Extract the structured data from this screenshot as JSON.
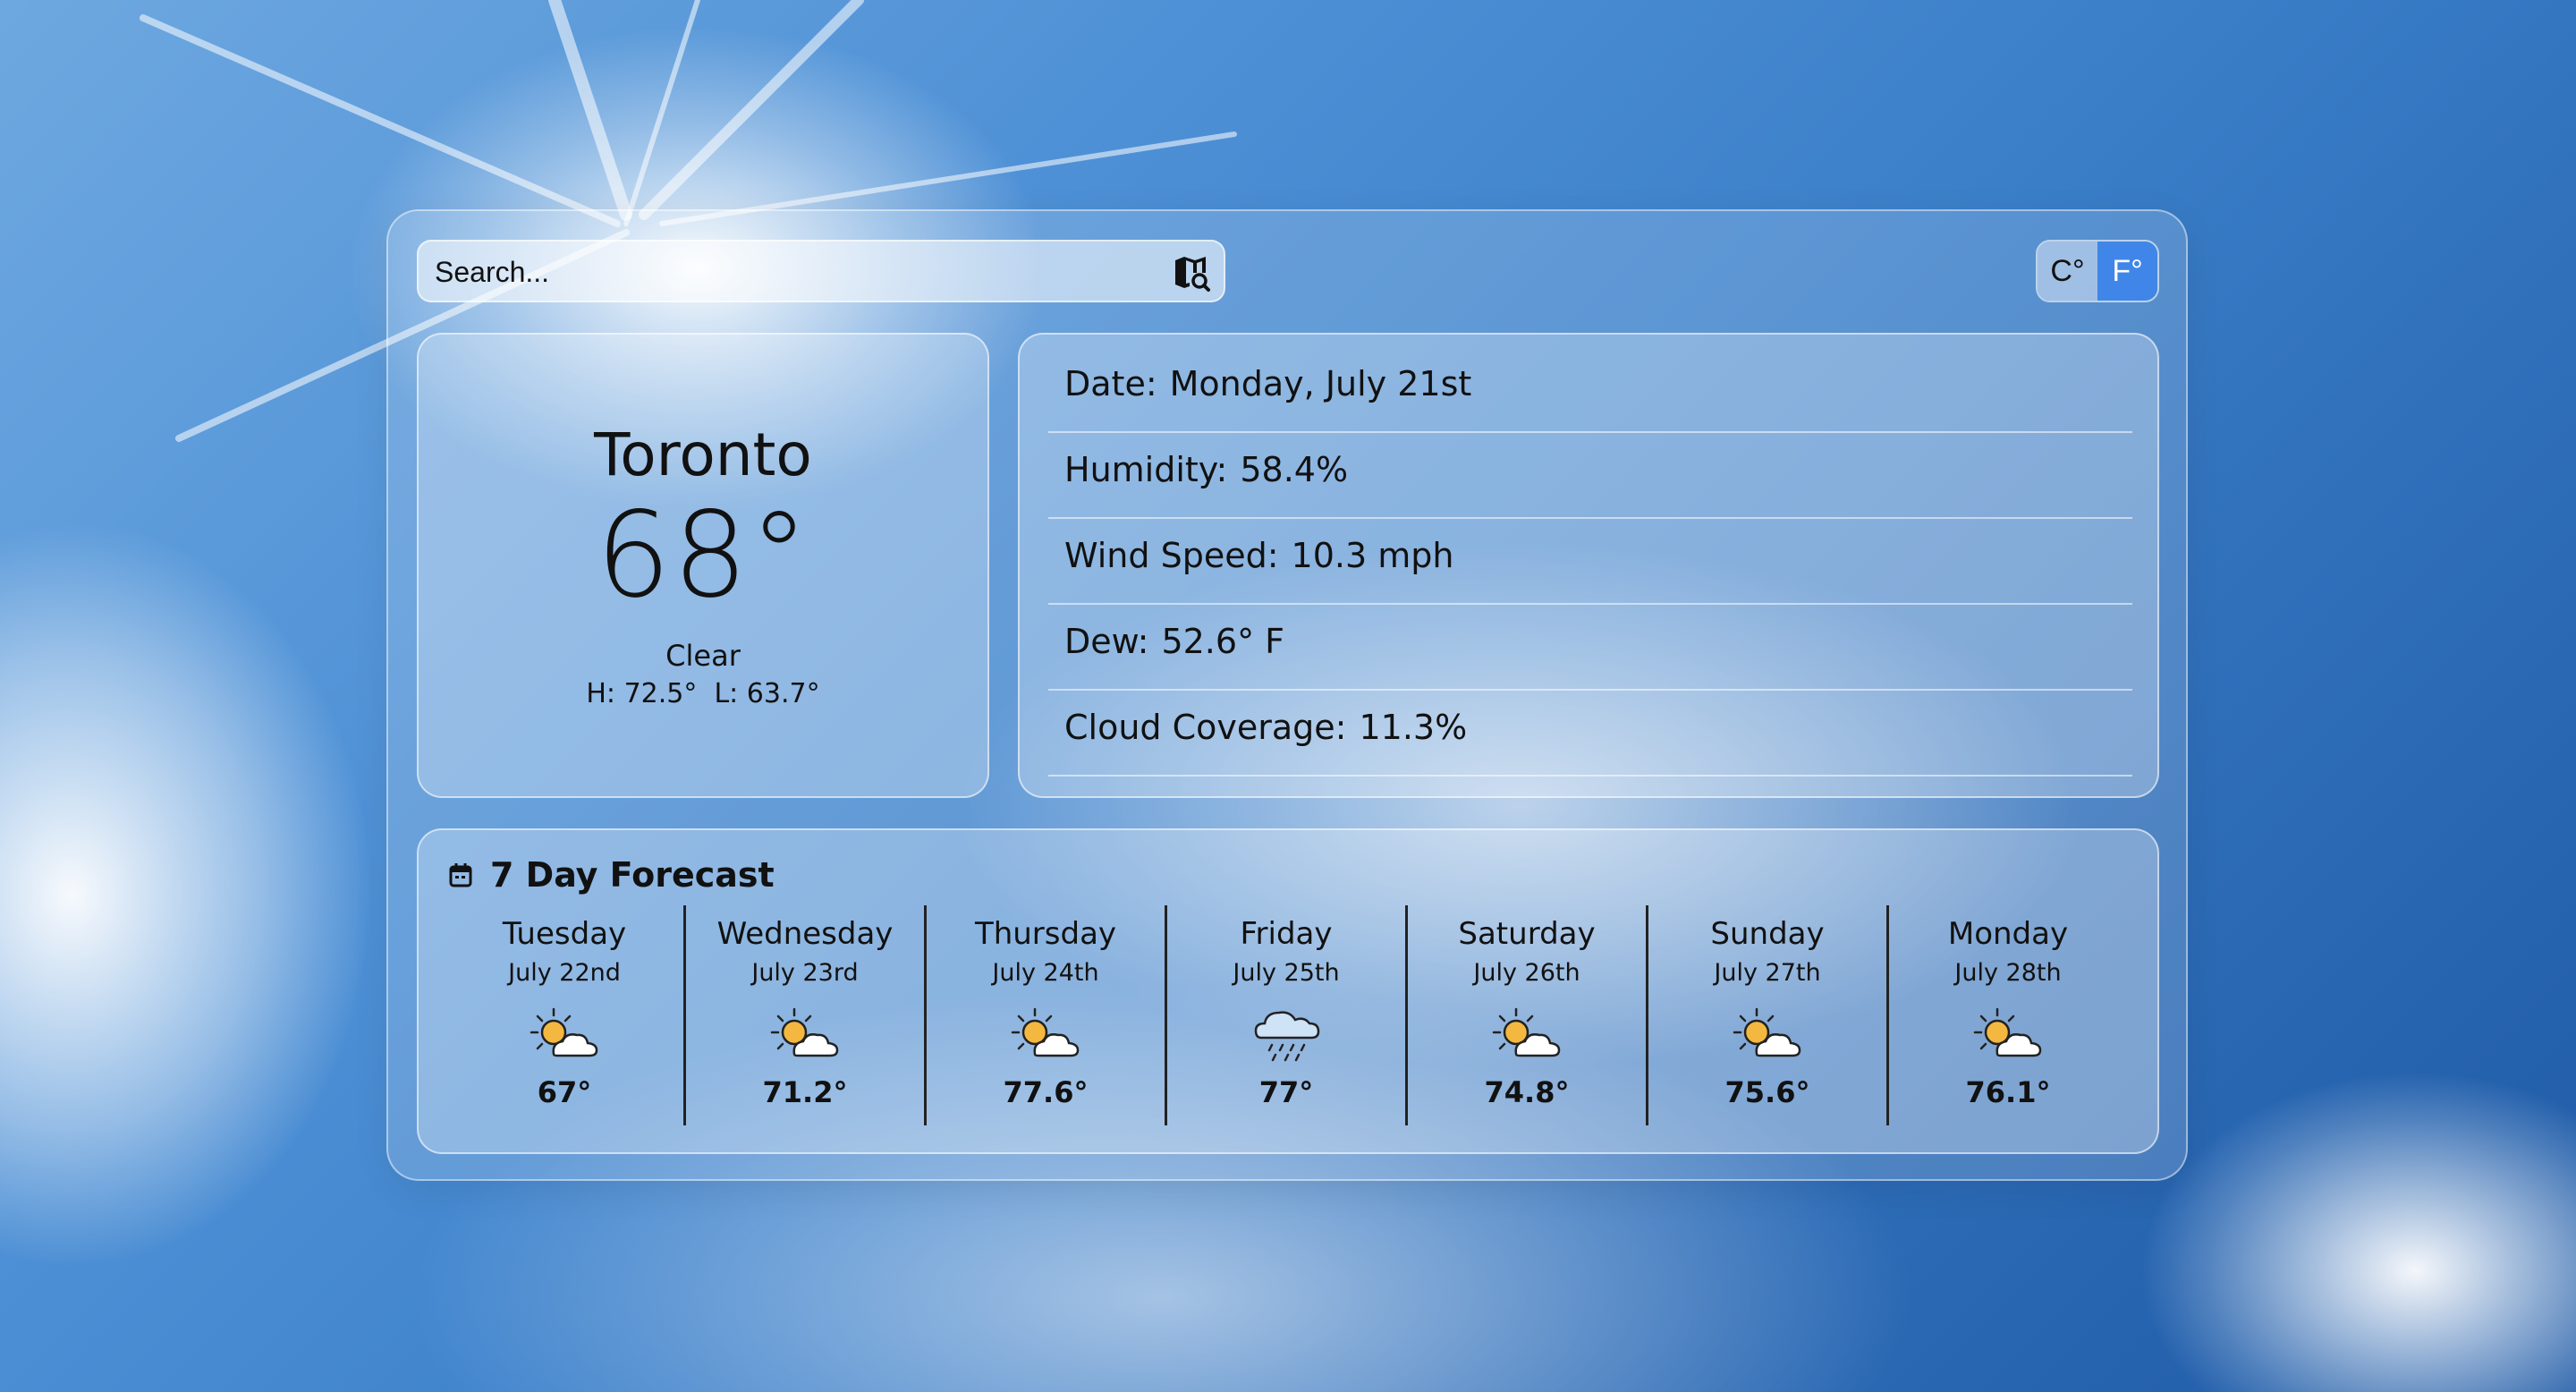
{
  "search": {
    "placeholder": "Search..."
  },
  "units": {
    "celsius": "C°",
    "fahrenheit": "F°",
    "selected": "F°",
    "accent": "#3f86e8"
  },
  "current": {
    "city": "Toronto",
    "temperature": "68°",
    "condition": "Clear",
    "high": "H: 72.5°",
    "low": "L: 63.7°"
  },
  "details": [
    {
      "label": "Date:",
      "value": "Monday, July 21st"
    },
    {
      "label": "Humidity:",
      "value": "58.4%"
    },
    {
      "label": "Wind Speed:",
      "value": "10.3 mph"
    },
    {
      "label": "Dew:",
      "value": "52.6° F"
    },
    {
      "label": "Cloud Coverage:",
      "value": "11.3%"
    }
  ],
  "forecast": {
    "title": "7 Day Forecast",
    "title_icon": "calendar-icon",
    "days": [
      {
        "day": "Tuesday",
        "date": "July 22nd",
        "icon": "partly-cloudy-icon",
        "temp": "67°"
      },
      {
        "day": "Wednesday",
        "date": "July 23rd",
        "icon": "partly-cloudy-icon",
        "temp": "71.2°"
      },
      {
        "day": "Thursday",
        "date": "July 24th",
        "icon": "partly-cloudy-icon",
        "temp": "77.6°"
      },
      {
        "day": "Friday",
        "date": "July 25th",
        "icon": "rain-icon",
        "temp": "77°"
      },
      {
        "day": "Saturday",
        "date": "July 26th",
        "icon": "partly-cloudy-icon",
        "temp": "74.8°"
      },
      {
        "day": "Sunday",
        "date": "July 27th",
        "icon": "partly-cloudy-icon",
        "temp": "75.6°"
      },
      {
        "day": "Monday",
        "date": "July 28th",
        "icon": "partly-cloudy-icon",
        "temp": "76.1°"
      }
    ]
  }
}
